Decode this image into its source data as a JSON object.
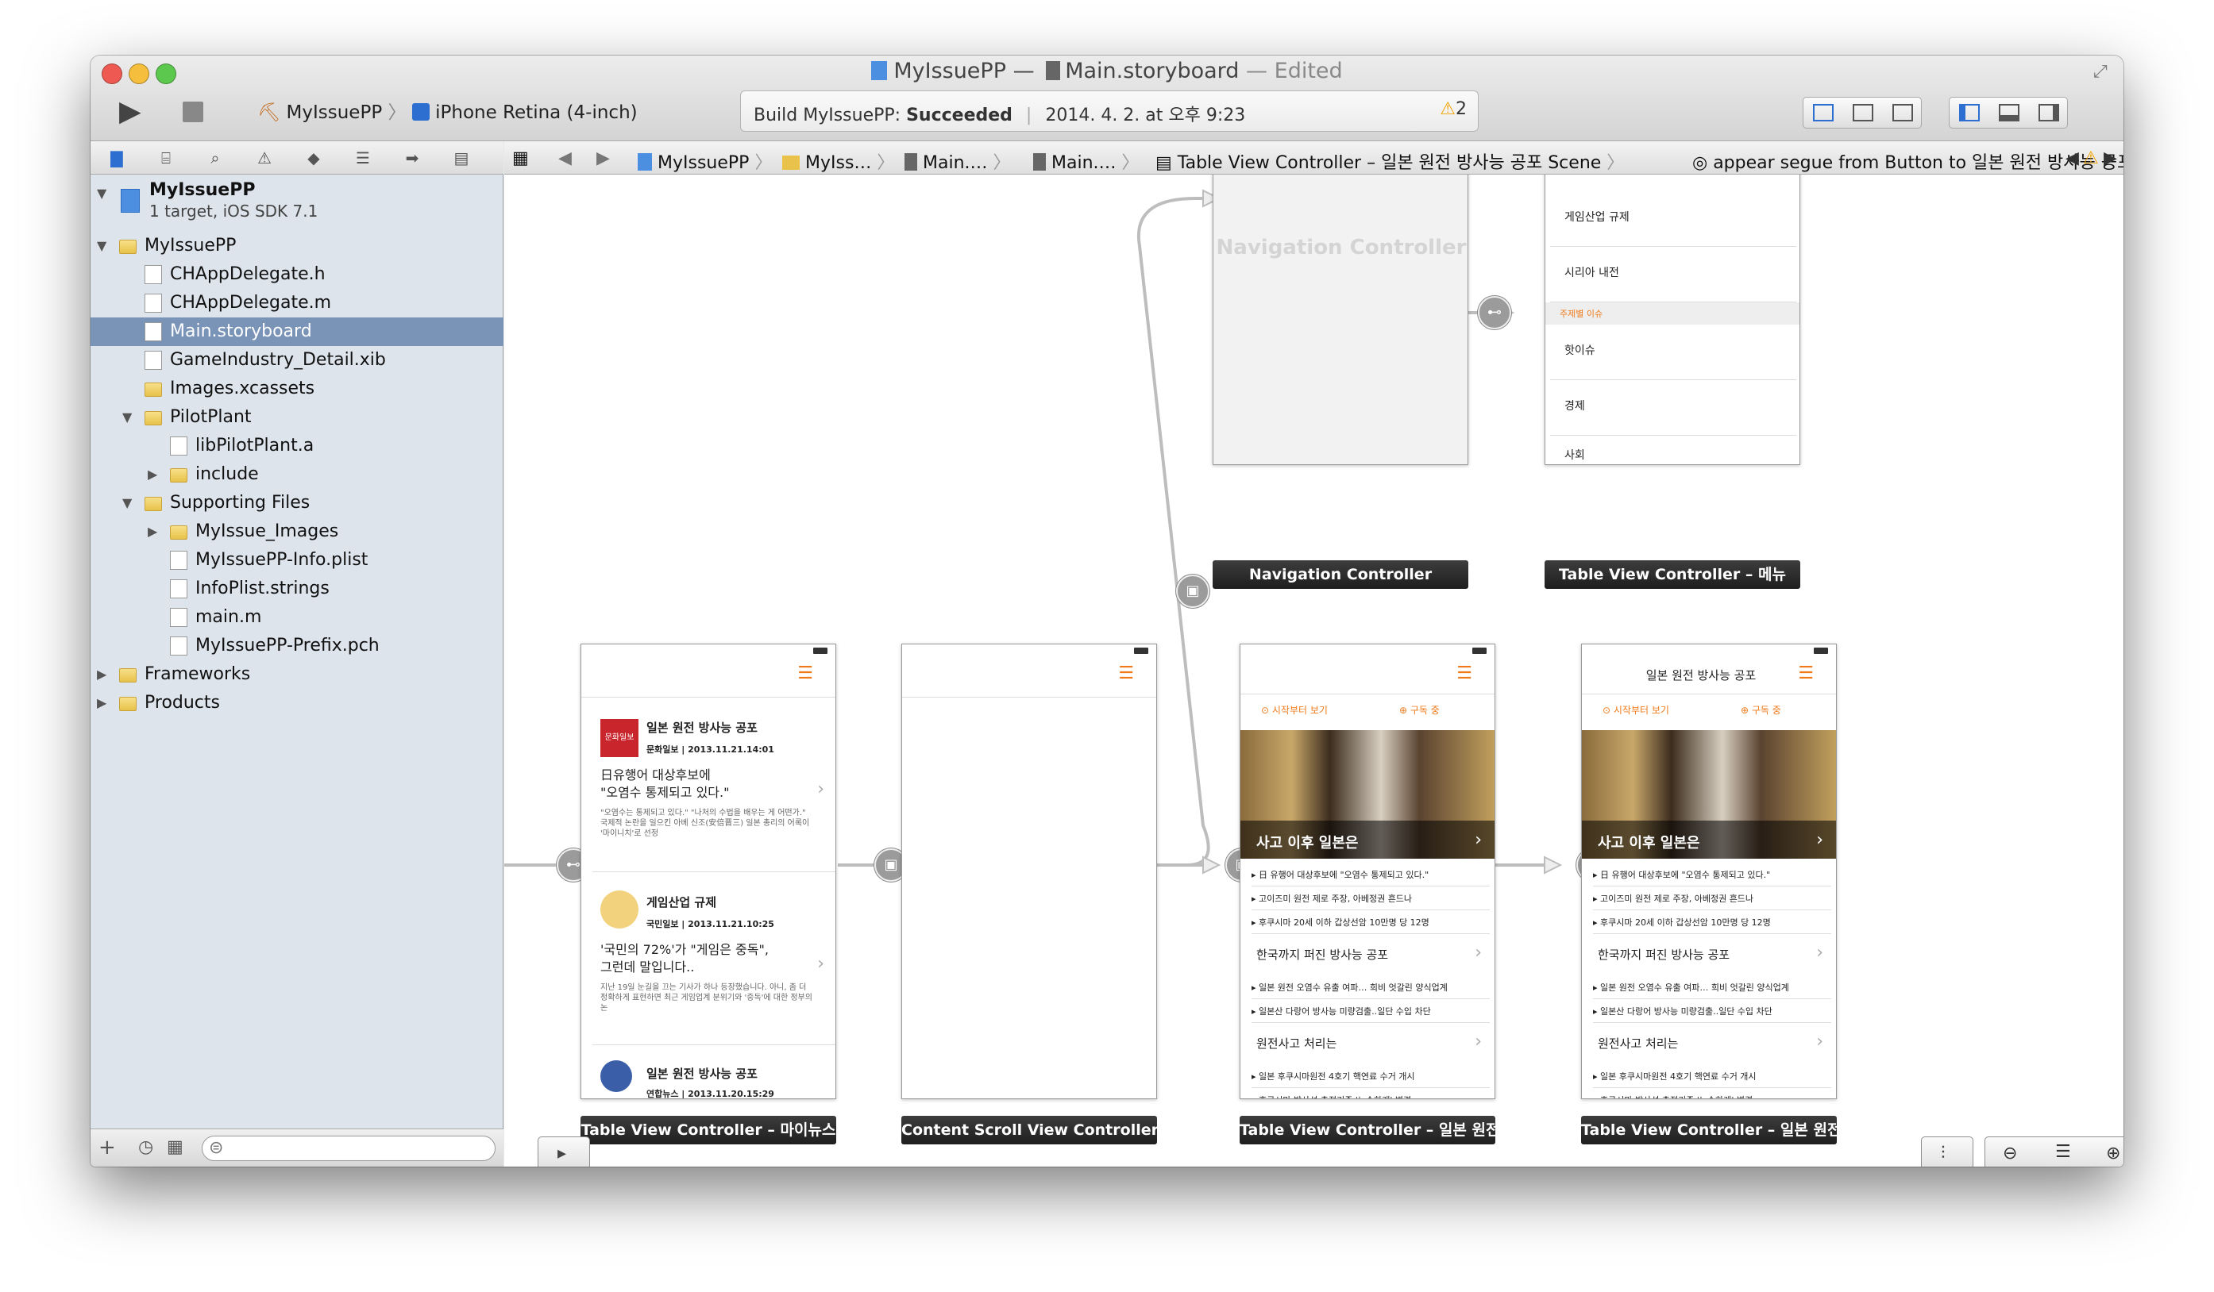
{
  "window": {
    "title_project": "MyIssuePP",
    "title_separator": "—",
    "title_file": "Main.storyboard",
    "title_state": "— Edited"
  },
  "toolbar": {
    "scheme": "MyIssuePP",
    "destination": "iPhone Retina (4-inch)",
    "status_prefix": "Build MyIssuePP:",
    "status_result": "Succeeded",
    "status_time": "2014. 4. 2. at 오후 9:23",
    "warning_count": "2"
  },
  "navigator": {
    "project": {
      "name": "MyIssuePP",
      "subtitle": "1 target, iOS SDK 7.1"
    },
    "items": [
      {
        "label": "MyIssuePP",
        "kind": "folder",
        "level": 1,
        "tri": "▼"
      },
      {
        "label": "CHAppDelegate.h",
        "kind": "file",
        "level": 2,
        "tri": ""
      },
      {
        "label": "CHAppDelegate.m",
        "kind": "file",
        "level": 2,
        "tri": ""
      },
      {
        "label": "Main.storyboard",
        "kind": "file",
        "level": 2,
        "tri": "",
        "selected": true
      },
      {
        "label": "GameIndustry_Detail.xib",
        "kind": "file",
        "level": 2,
        "tri": ""
      },
      {
        "label": "Images.xcassets",
        "kind": "folder",
        "level": 2,
        "tri": ""
      },
      {
        "label": "PilotPlant",
        "kind": "folder",
        "level": 2,
        "tri": "▼"
      },
      {
        "label": "libPilotPlant.a",
        "kind": "file",
        "level": 3,
        "tri": ""
      },
      {
        "label": "include",
        "kind": "folder",
        "level": 3,
        "tri": "▶"
      },
      {
        "label": "Supporting Files",
        "kind": "folder",
        "level": 2,
        "tri": "▼"
      },
      {
        "label": "MyIssue_Images",
        "kind": "folder",
        "level": 3,
        "tri": "▶"
      },
      {
        "label": "MyIssuePP-Info.plist",
        "kind": "file",
        "level": 3,
        "tri": ""
      },
      {
        "label": "InfoPlist.strings",
        "kind": "file",
        "level": 3,
        "tri": ""
      },
      {
        "label": "main.m",
        "kind": "file",
        "level": 3,
        "tri": ""
      },
      {
        "label": "MyIssuePP-Prefix.pch",
        "kind": "file",
        "level": 3,
        "tri": ""
      },
      {
        "label": "Frameworks",
        "kind": "folder",
        "level": 1,
        "tri": "▶"
      },
      {
        "label": "Products",
        "kind": "folder",
        "level": 1,
        "tri": "▶"
      }
    ]
  },
  "jumpbar": {
    "crumbs": [
      "MyIssuePP",
      "MyIss…",
      "Main.…",
      "Main.…",
      "Table View Controller – 일본 원전 방사능 공포 Scene",
      "appear segue from Button to 일본 원전 방사능 공포"
    ]
  },
  "canvas": {
    "nav_controller_placeholder": "Navigation Controller",
    "menu_rows": [
      "게임산업 규제",
      "시리아 내전",
      "핫이슈",
      "경제",
      "사회"
    ],
    "menu_section": "주제별 이슈",
    "docks": {
      "nav": "Navigation Controller",
      "menu": "Table View Controller – 메뉴",
      "minews": "Table View Controller – 마이뉴스",
      "content": "Content Scroll View Controller –",
      "detail1": "Table View Controller – 일본 원전",
      "detail2": "Table View Controller – 일본 원전"
    },
    "minews": {
      "item1_title": "일본 원전 방사능 공포",
      "item1_source": "문화일보 | 2013.11.21.14:01",
      "item1_logo": "문화일보",
      "item1_headline": "日유행어 대상후보에\n\"오염수 통제되고 있다.\"",
      "item1_body": "\"오염수는 통제되고 있다.\" \"나처의 수법을 배우는 게 어떤가.\" 국제적 논란을 일으킨 아베 신조(安倍晋三) 일본 총리의 어록이 '마이니치'로 선정",
      "item2_title": "게임산업 규제",
      "item2_source": "국민일보 | 2013.11.21.10:25",
      "item2_headline": "'국민의 72%'가 \"게임은 중독\",\n그런데 말입니다..",
      "item2_body": "지난 19일 눈길을 끄는 기사가 하나 등장했습니다. 아니, 좀 더 정확하게 표현하면 최근 게임업계 분위기와 '중독'에 대한 정부의 논",
      "item3_title": "일본 원전 방사능 공포",
      "item3_source": "연합뉴스 | 2013.11.20.15:29"
    },
    "detail": {
      "header_title": "일본 원전 방사능 공포",
      "tab_start": "시작부터 보기",
      "tab_subscribe": "구독 중",
      "photo_caption": "사고 이후 일본은",
      "bullets1": [
        "日 유행어 대상후보에 \"오염수 통제되고 있다.\"",
        "고이즈미 원전 제로 주장, 아베정권 흔드나",
        "후쿠시마 20세 이하 갑상선암 10만명 당 12명"
      ],
      "section2": "한국까지 퍼진 방사능 공포",
      "bullets2": [
        "일본 원전 오염수 유출 여파… 희비 엇갈린 양식업계",
        "일본산 다랑어 방사능 미량검출..일단 수입 차단"
      ],
      "section3": "원전사고 처리는",
      "bullets3": [
        "일본 후쿠시마원전 4호기 핵연료 수거 개시",
        "후쿠시마 방사선 측정기준 '느슨하게' 변경"
      ]
    }
  },
  "colors": {
    "accent": "#f07a1a",
    "selection": "#7a94b8",
    "dock": "#2a2a2a",
    "sidebar": "#dde4ec"
  }
}
